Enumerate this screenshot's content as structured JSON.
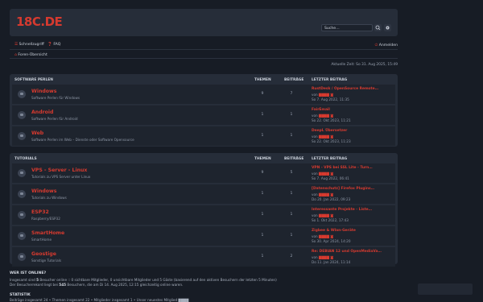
{
  "header": {
    "logo": "18C.DE",
    "search_placeholder": "Suche…",
    "search_icon": "search-icon",
    "gear_icon": "gear-icon"
  },
  "nav": {
    "left": [
      {
        "label": "Schnellzugriff",
        "icon": "menu-icon"
      },
      {
        "label": "FAQ",
        "icon": "help-icon"
      }
    ],
    "login": "Anmelden",
    "breadcrumb": "Foren-Übersicht",
    "time": "Aktuelle Zeit: So 31. Aug 2025, 15:49"
  },
  "columns": {
    "topics": "THEMEN",
    "posts": "BEITRÄGE",
    "lastpost": "LETZTER BEITRAG"
  },
  "sections": [
    {
      "name": "SOFTWARE PERLEN",
      "forums": [
        {
          "title": "Windows",
          "desc": "Software Perlen für Windows",
          "topics": "9",
          "posts": "7",
          "lp_title": "RustDesk / OpenSource Remote…",
          "lp_by": "von",
          "lp_user": "▇▇▇▇",
          "lp_date": "So 7. Aug 2022, 11:35"
        },
        {
          "title": "Android",
          "desc": "Software Perlen für Android",
          "topics": "1",
          "posts": "1",
          "lp_title": "FairEmail",
          "lp_by": "von",
          "lp_user": "▇▇▇▇",
          "lp_date": "So 22. Okt 2023, 11:21"
        },
        {
          "title": "Web",
          "desc": "Software Perlen im Web – Dienste oder Software Opensource",
          "topics": "1",
          "posts": "1",
          "lp_title": "DeepL Übersetzer",
          "lp_by": "von",
          "lp_user": "▇▇▇▇",
          "lp_date": "So 22. Okt 2023, 11:23"
        }
      ]
    },
    {
      "name": "TUTORIALS",
      "forums": [
        {
          "title": "VPS - Server - Linux",
          "desc": "Tutorials zu VPS Server unter Linux",
          "topics": "9",
          "posts": "5",
          "lp_title": "VPN - VPS bei SSL Lite - Turn…",
          "lp_by": "von",
          "lp_user": "▇▇▇▇",
          "lp_date": "So 7. Aug 2022, 06:41"
        },
        {
          "title": "Windows",
          "desc": "Tutorials zu Windows",
          "topics": "1",
          "posts": "1",
          "lp_title": "[Datenschutz] Firefox Plugins…",
          "lp_by": "von",
          "lp_user": "▇▇▇▇",
          "lp_date": "Do 20. Jan 2022, 09:23"
        },
        {
          "title": "ESP32",
          "desc": "Raspberry/ESP32",
          "topics": "1",
          "posts": "1",
          "lp_title": "Interessante Projekte - Liste…",
          "lp_by": "von",
          "lp_user": "▇▇▇▇",
          "lp_date": "So 1. Okt 2022, 17:43"
        },
        {
          "title": "SmartHome",
          "desc": "SmartHome",
          "topics": "1",
          "posts": "1",
          "lp_title": "Zigbee & Wlan-Geräte",
          "lp_by": "von",
          "lp_user": "▇▇▇▇",
          "lp_date": "So 30. Apr 2024, 14:20"
        },
        {
          "title": "Geostige",
          "desc": "Sonstige Tutorials",
          "topics": "1",
          "posts": "2",
          "lp_title": "Re: DEBIAN 12 und OpenMediaVa…",
          "lp_by": "von",
          "lp_user": "▇▇▇▇",
          "lp_date": "Do 11. Jan 2024, 11:14"
        }
      ]
    }
  ],
  "online": {
    "heading": "WER IST ONLINE?",
    "line1_pre": "Insgesamt sind",
    "line1_count": "5",
    "line1_post": "Besucher online :: 0 sichtbare Mitglieder, 0 unsichtbare Mitglieder und 5 Gäste (basierend auf den aktiven Besuchern der letzten 5 Minuten)",
    "line2_pre": "Der Besucherrekord liegt bei",
    "line2_count": "545",
    "line2_post": "Besuchern, die am Di 14. Aug 2025, 12:15 gleichzeitig online waren."
  },
  "stats": {
    "heading": "STATISTIK",
    "line": "Beiträge insgesamt 24 • Themen insgesamt 22 • Mitglieder insgesamt 1 • Unser neuestes Mitglied ▇▇▇▇"
  }
}
